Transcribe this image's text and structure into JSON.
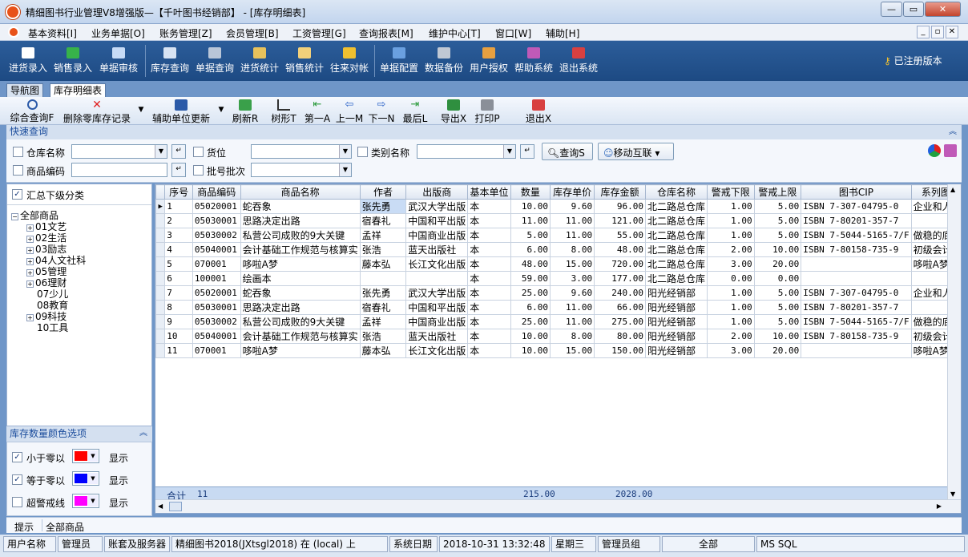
{
  "window": {
    "title": "精细图书行业管理V8增强版—【千叶图书经销部】 - [库存明细表]"
  },
  "menu": [
    "基本资料[I]",
    "业务单据[O]",
    "账务管理[Z]",
    "会员管理[B]",
    "工资管理[G]",
    "查询报表[M]",
    "维护中心[T]",
    "窗口[W]",
    "辅助[H]"
  ],
  "toolbar": [
    {
      "label": "进货录入",
      "color": "#ffffff"
    },
    {
      "label": "销售录入",
      "color": "#37b24a"
    },
    {
      "label": "单据审核",
      "color": "#c7dbf6"
    },
    {
      "label": "库存查询",
      "color": "#d7e3f3"
    },
    {
      "label": "单据查询",
      "color": "#b9c6d8"
    },
    {
      "label": "进货统计",
      "color": "#e8c25c"
    },
    {
      "label": "销售统计",
      "color": "#f2d07a"
    },
    {
      "label": "往来对帐",
      "color": "#f0c030"
    },
    {
      "label": "单据配置",
      "color": "#6aa0e0"
    },
    {
      "label": "数据备份",
      "color": "#c0c8d4"
    },
    {
      "label": "用户授权",
      "color": "#e8a040"
    },
    {
      "label": "帮助系统",
      "color": "#c05ab8"
    },
    {
      "label": "退出系统",
      "color": "#d84040"
    }
  ],
  "registered": "已注册版本",
  "tabs": [
    "导航图",
    "库存明细表"
  ],
  "subtoolbar": [
    "综合查询F",
    "删除零库存记录",
    "辅助单位更新",
    "刷新R",
    "树形T",
    "第一A",
    "上一M",
    "下一N",
    "最后L",
    "导出X",
    "打印P",
    "退出X"
  ],
  "quicksearch": {
    "title": "快速查询",
    "labels": {
      "warehouse": "仓库名称",
      "shelf": "货位",
      "category": "类别名称",
      "code": "商品编码",
      "batch": "批号批次"
    },
    "query_btn": "查询S",
    "mobile_btn": "移动互联"
  },
  "left": {
    "summary_label": "汇总下级分类",
    "tree_root": "全部商品",
    "tree": [
      "01文艺",
      "02生活",
      "03励志",
      "04人文社科",
      "05管理",
      "06理财",
      "07少儿",
      "08教育",
      "09科技",
      "10工具"
    ]
  },
  "colors": {
    "title": "库存数量颜色选项",
    "rows": [
      {
        "label": "小于零以",
        "color": "#ff0000",
        "show": "显示",
        "checked": true
      },
      {
        "label": "等于零以",
        "color": "#0000ff",
        "show": "显示",
        "checked": true
      },
      {
        "label": "超警戒线",
        "color": "#ff00ff",
        "show": "显示",
        "checked": false
      }
    ]
  },
  "grid": {
    "columns": [
      "序号",
      "商品编码",
      "商品名称",
      "作者",
      "出版商",
      "基本单位",
      "数量",
      "库存单价",
      "库存金额",
      "仓库名称",
      "警戒下限",
      "警戒上限",
      "图书CIP",
      "系列图"
    ],
    "rows": [
      [
        "1",
        "05020001",
        "蛇吞象",
        "张先勇",
        "武汉大学出版",
        "本",
        "10.00",
        "9.60",
        "96.00",
        "北二路总仓库",
        "1.00",
        "5.00",
        "ISBN 7-307-04795-0",
        "企业和人"
      ],
      [
        "2",
        "05030001",
        "思路决定出路",
        "宿春礼",
        "中国和平出版",
        "本",
        "11.00",
        "11.00",
        "121.00",
        "北二路总仓库",
        "1.00",
        "5.00",
        "ISBN 7-80201-357-7",
        ""
      ],
      [
        "3",
        "05030002",
        "私营公司成败的9大关键",
        "孟祥",
        "中国商业出版",
        "本",
        "5.00",
        "11.00",
        "55.00",
        "北二路总仓库",
        "1.00",
        "5.00",
        "ISBN 7-5044-5165-7/F",
        "做稳的底"
      ],
      [
        "4",
        "05040001",
        "会计基础工作规范与核算实",
        "张浩",
        "蓝天出版社",
        "本",
        "6.00",
        "8.00",
        "48.00",
        "北二路总仓库",
        "2.00",
        "10.00",
        "ISBN 7-80158-735-9",
        "初级会计"
      ],
      [
        "5",
        "070001",
        "哆啦A梦",
        "藤本弘",
        "长江文化出版",
        "本",
        "48.00",
        "15.00",
        "720.00",
        "北二路总仓库",
        "3.00",
        "20.00",
        "",
        "哆啦A梦系"
      ],
      [
        "6",
        "100001",
        "绘画本",
        "",
        "",
        "本",
        "59.00",
        "3.00",
        "177.00",
        "北二路总仓库",
        "0.00",
        "0.00",
        "",
        ""
      ],
      [
        "7",
        "05020001",
        "蛇吞象",
        "张先勇",
        "武汉大学出版",
        "本",
        "25.00",
        "9.60",
        "240.00",
        "阳光经销部",
        "1.00",
        "5.00",
        "ISBN 7-307-04795-0",
        "企业和人"
      ],
      [
        "8",
        "05030001",
        "思路决定出路",
        "宿春礼",
        "中国和平出版",
        "本",
        "6.00",
        "11.00",
        "66.00",
        "阳光经销部",
        "1.00",
        "5.00",
        "ISBN 7-80201-357-7",
        ""
      ],
      [
        "9",
        "05030002",
        "私营公司成败的9大关键",
        "孟祥",
        "中国商业出版",
        "本",
        "25.00",
        "11.00",
        "275.00",
        "阳光经销部",
        "1.00",
        "5.00",
        "ISBN 7-5044-5165-7/F",
        "做稳的底"
      ],
      [
        "10",
        "05040001",
        "会计基础工作规范与核算实",
        "张浩",
        "蓝天出版社",
        "本",
        "10.00",
        "8.00",
        "80.00",
        "阳光经销部",
        "2.00",
        "10.00",
        "ISBN 7-80158-735-9",
        "初级会计"
      ],
      [
        "11",
        "070001",
        "哆啦A梦",
        "藤本弘",
        "长江文化出版",
        "本",
        "10.00",
        "15.00",
        "150.00",
        "阳光经销部",
        "3.00",
        "20.00",
        "",
        "哆啦A梦系"
      ]
    ],
    "footer": {
      "label": "合计",
      "count": "11",
      "qty": "215.00",
      "amount": "2028.00"
    }
  },
  "hint": {
    "label": "提示",
    "value": "全部商品"
  },
  "status": [
    "用户名称",
    "管理员",
    "账套及服务器",
    "精细图书2018(JXtsgl2018) 在 (local) 上",
    "系统日期",
    "2018-10-31  13:32:48",
    "星期三",
    "管理员组",
    "全部",
    "MS SQL"
  ]
}
